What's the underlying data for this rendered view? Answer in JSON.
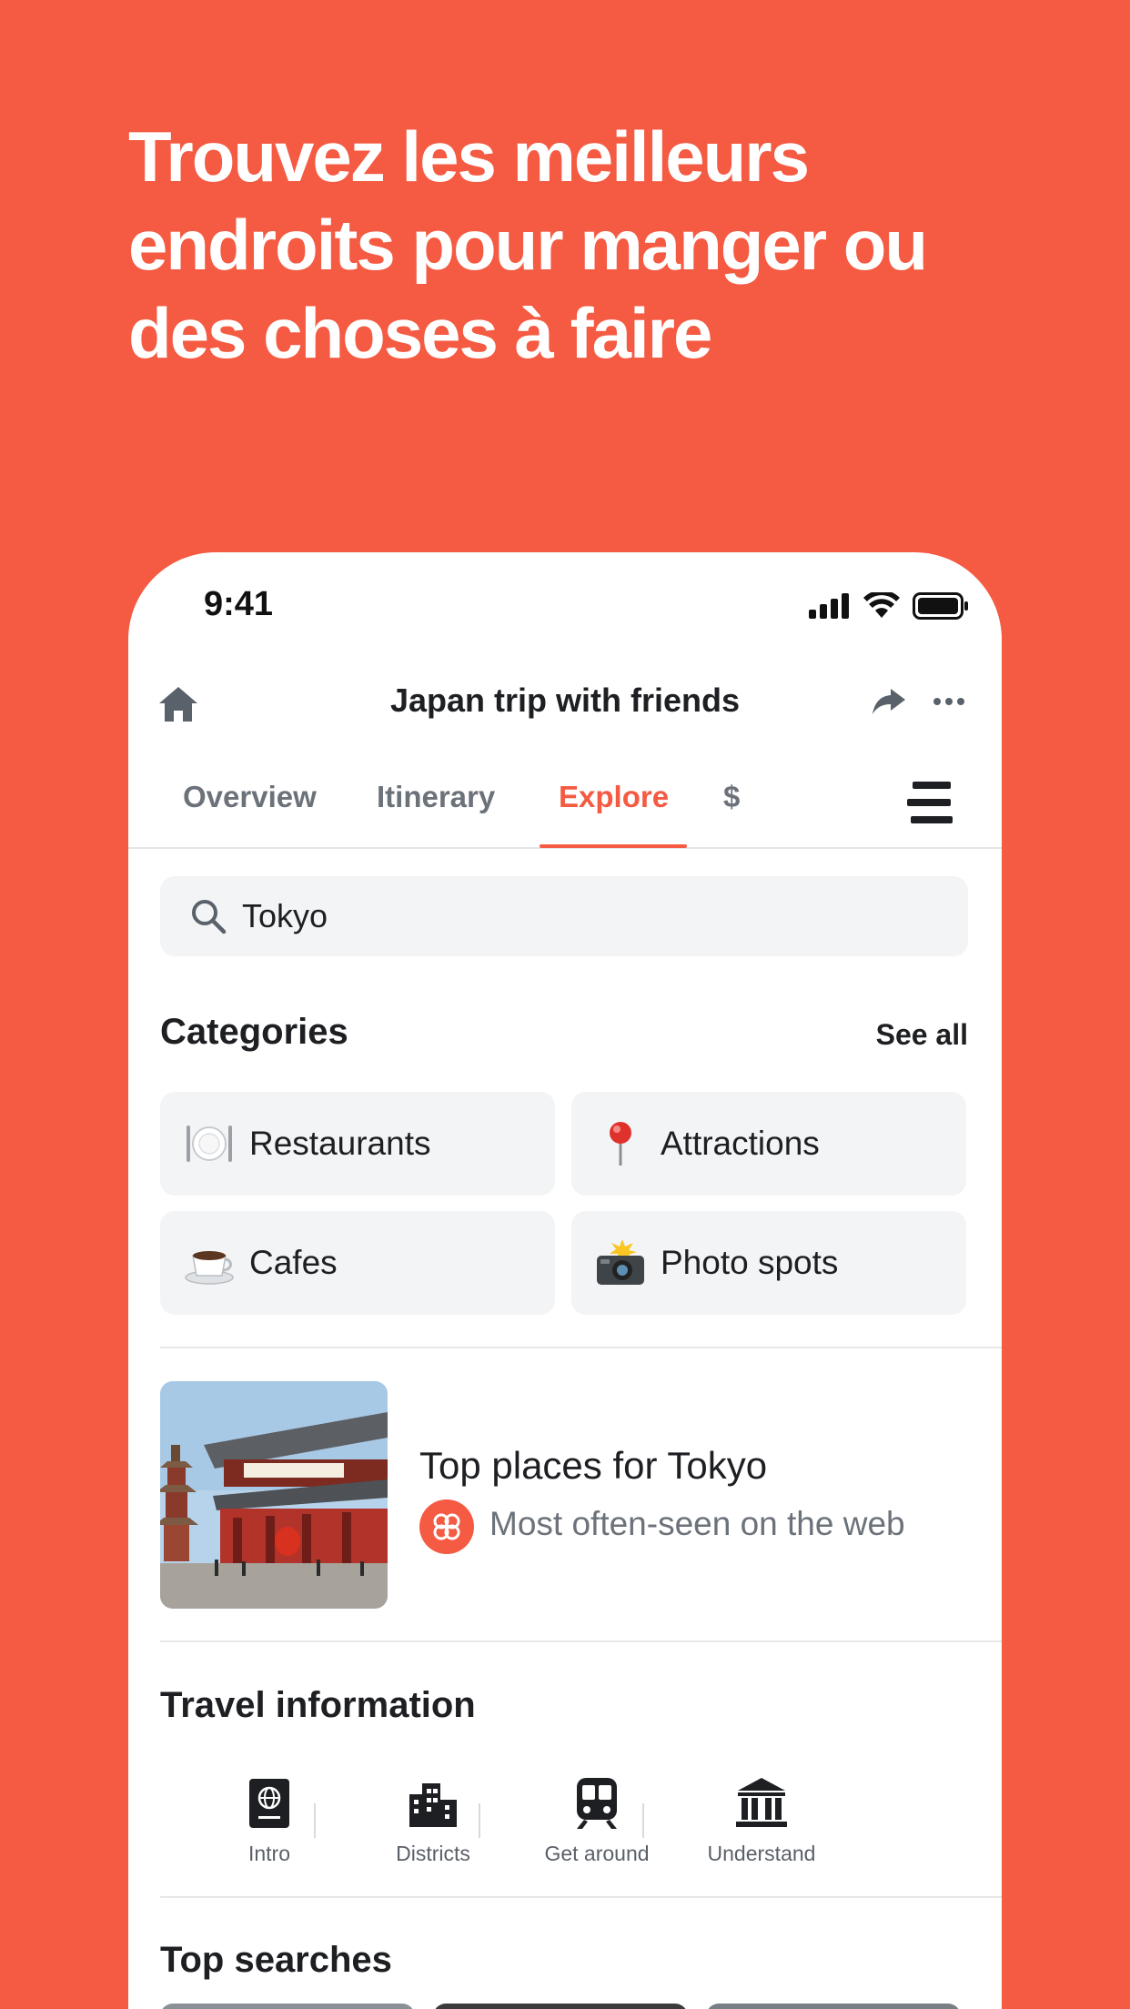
{
  "headline": {
    "line1": "Trouvez les meilleurs",
    "line2": "endroits pour manger ou",
    "line3": "des choses à faire"
  },
  "status_bar": {
    "time": "9:41"
  },
  "navbar": {
    "title": "Japan trip with friends"
  },
  "tabs": [
    {
      "label": "Overview",
      "active": false
    },
    {
      "label": "Itinerary",
      "active": false
    },
    {
      "label": "Explore",
      "active": true
    },
    {
      "label": "$",
      "active": false
    }
  ],
  "search": {
    "value": "Tokyo"
  },
  "categories": {
    "title": "Categories",
    "see_all": "See all",
    "items": [
      {
        "label": "Restaurants",
        "icon": "fork-knife-plate-icon"
      },
      {
        "label": "Attractions",
        "icon": "red-pin-icon"
      },
      {
        "label": "Cafes",
        "icon": "coffee-cup-icon"
      },
      {
        "label": "Photo spots",
        "icon": "camera-flash-icon"
      }
    ]
  },
  "top_places": {
    "title": "Top places for Tokyo",
    "subtitle": "Most often-seen on the web"
  },
  "travel_info": {
    "title": "Travel information",
    "items": [
      {
        "label": "Intro",
        "icon": "passport-icon"
      },
      {
        "label": "Districts",
        "icon": "city-buildings-icon"
      },
      {
        "label": "Get around",
        "icon": "train-icon"
      },
      {
        "label": "Understand",
        "icon": "museum-icon"
      }
    ]
  },
  "top_searches": {
    "title": "Top searches"
  },
  "colors": {
    "brand": "#F55A42",
    "text": "#1d1f22",
    "muted": "#6c727a",
    "chip_bg": "#f3f4f5"
  }
}
